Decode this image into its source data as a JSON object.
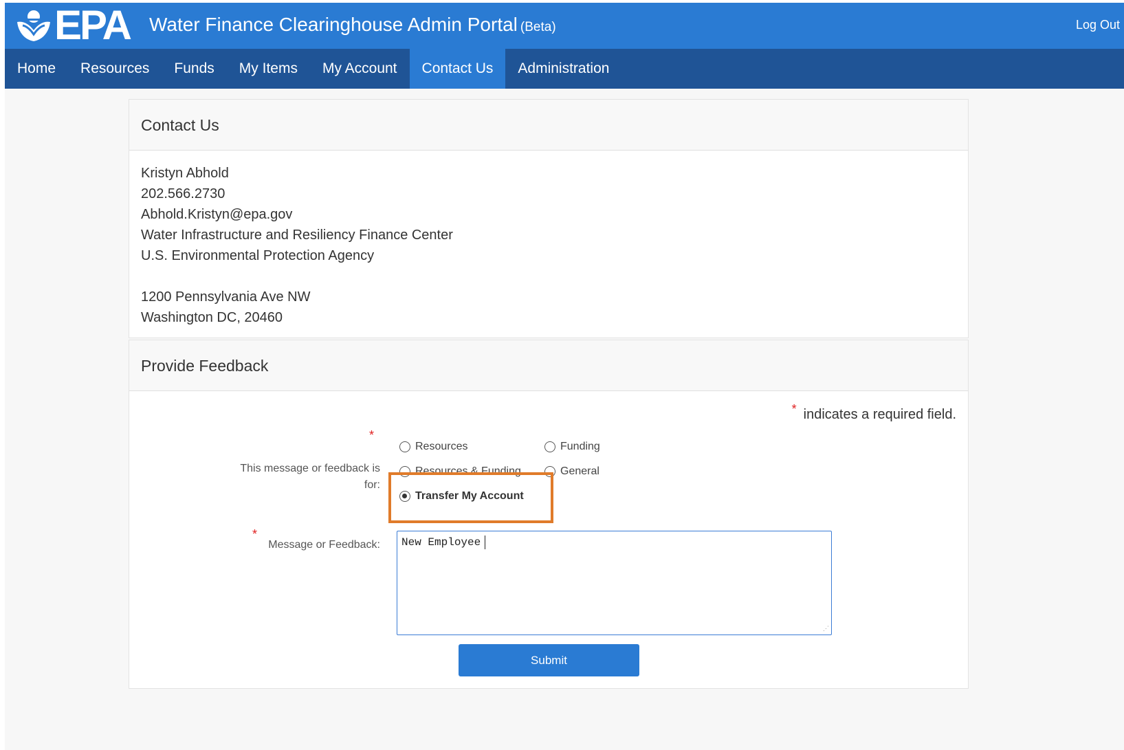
{
  "header": {
    "logo_text": "EPA",
    "title": "Water Finance Clearinghouse Admin Portal",
    "title_badge": "(Beta)",
    "logout_label": "Log Out",
    "bg_color": "#2a7bd3"
  },
  "nav": {
    "items": [
      "Home",
      "Resources",
      "Funds",
      "My Items",
      "My Account",
      "Contact Us",
      "Administration"
    ],
    "active": "Contact Us",
    "bg_color": "#1f5496"
  },
  "contact": {
    "heading": "Contact Us",
    "name": "Kristyn Abhold",
    "phone": "202.566.2730",
    "email": "Abhold.Kristyn@epa.gov",
    "center": "Water Infrastructure and Resiliency Finance Center",
    "agency": "U.S. Environmental Protection Agency",
    "street": "1200 Pennsylvania Ave NW",
    "city": "Washington DC, 20460"
  },
  "feedback": {
    "heading": "Provide Feedback",
    "required_star": "*",
    "required_note": "indicates a required field.",
    "category_label": "This message or feedback is for:",
    "options": [
      {
        "label": "Resources",
        "selected": false
      },
      {
        "label": "Funding",
        "selected": false
      },
      {
        "label": "Resources & Funding",
        "selected": false
      },
      {
        "label": "General",
        "selected": false
      },
      {
        "label": "Transfer My Account",
        "selected": true
      }
    ],
    "message_label": "Message or Feedback:",
    "message_value": "New Employee",
    "submit_label": "Submit",
    "highlight_color": "#e07b2a"
  }
}
